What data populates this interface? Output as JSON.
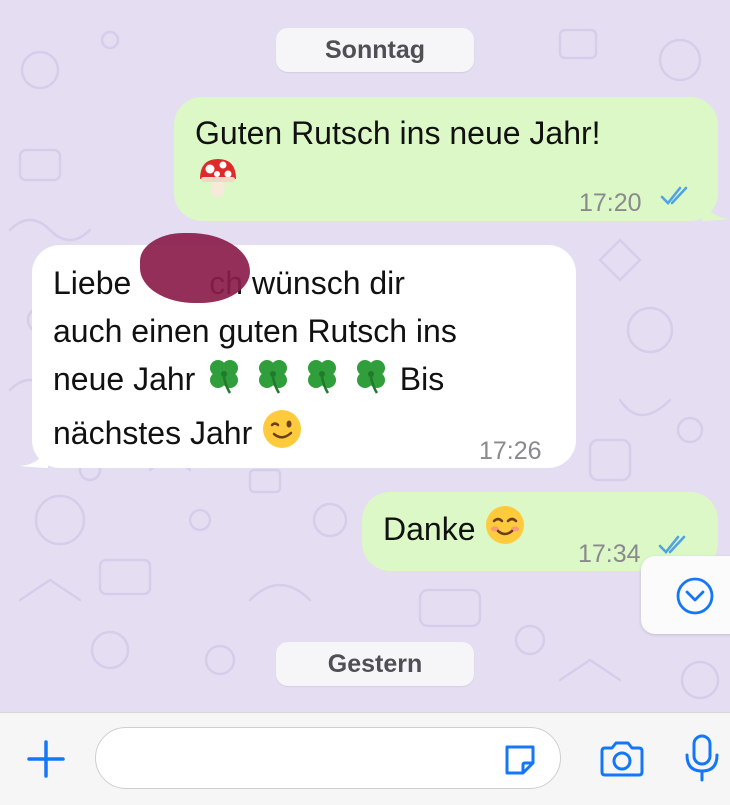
{
  "chat": {
    "date_dividers": [
      "Sonntag",
      "Gestern"
    ],
    "messages": [
      {
        "direction": "outgoing",
        "lines": [
          "Guten Rutsch ins neue Jahr!"
        ],
        "emoji": [
          "mushroom"
        ],
        "time": "17:20",
        "status": "read"
      },
      {
        "direction": "incoming",
        "lines": [
          "Liebe",
          "ch wünsch dir",
          "auch einen guten Rutsch ins",
          "neue Jahr",
          "Bis",
          "nächstes Jahr"
        ],
        "emoji": [
          "four-leaf-clover",
          "four-leaf-clover",
          "four-leaf-clover",
          "four-leaf-clover",
          "winking-face"
        ],
        "time": "17:26",
        "redacted_name": true
      },
      {
        "direction": "outgoing",
        "lines": [
          "Danke"
        ],
        "emoji": [
          "smiling-face"
        ],
        "time": "17:34",
        "status": "read"
      }
    ]
  },
  "composer": {
    "placeholder": "",
    "icons": [
      "plus-icon",
      "sticker-icon",
      "camera-icon",
      "microphone-icon"
    ]
  },
  "scroll_button": {
    "icon": "chevron-down-circle-icon"
  },
  "colors": {
    "chat_background": "#e5def2",
    "outgoing_bubble": "#dcf8c6",
    "incoming_bubble": "#ffffff",
    "read_ticks": "#4fa3e6",
    "accent_blue": "#1477f8"
  }
}
